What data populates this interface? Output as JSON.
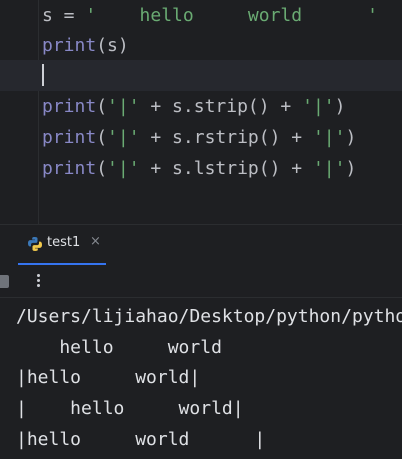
{
  "editor": {
    "line1": {
      "var": "s = ",
      "literal": "'    hello     world      '"
    },
    "line2": {
      "fn": "print",
      "rest": "(s)"
    },
    "line4": {
      "fn": "print",
      "open": "(",
      "q1": "'|'",
      "mid": " + s.strip() + ",
      "q2": "'|'",
      "close": ")"
    },
    "line5": {
      "fn": "print",
      "open": "(",
      "q1": "'|'",
      "mid": " + s.rstrip() + ",
      "q2": "'|'",
      "close": ")"
    },
    "line6": {
      "fn": "print",
      "open": "(",
      "q1": "'|'",
      "mid": " + s.lstrip() + ",
      "q2": "'|'",
      "close": ")"
    }
  },
  "run_panel": {
    "tab_label": "test1",
    "close_glyph": "×",
    "icons": [
      "python-icon",
      "close-icon",
      "stop-icon",
      "more-options-icon"
    ]
  },
  "console": {
    "lines": [
      "/Users/lijiahao/Desktop/python/pytho",
      "    hello     world",
      "|hello     world|",
      "|    hello     world|",
      "|hello     world      |"
    ]
  },
  "colors": {
    "background": "#1e1f22",
    "keyword": "#8888c6",
    "string": "#6aab73",
    "text": "#bcbec4",
    "tab_underline": "#3574f0"
  }
}
